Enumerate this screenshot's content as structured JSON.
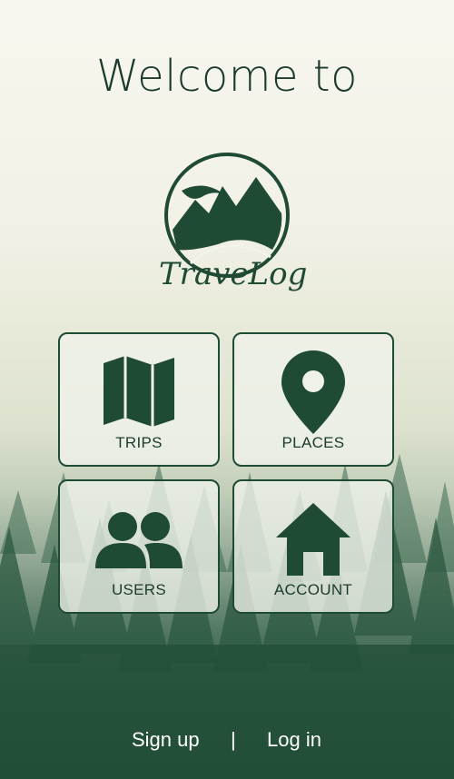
{
  "header": {
    "title": "Welcome to"
  },
  "brand": {
    "name": "TraveLog",
    "logo_icon": "mountain-logo-icon"
  },
  "tiles": [
    {
      "label": "TRIPS",
      "icon": "map-icon"
    },
    {
      "label": "PLACES",
      "icon": "location-pin-icon"
    },
    {
      "label": "USERS",
      "icon": "users-icon"
    },
    {
      "label": "ACCOUNT",
      "icon": "home-icon"
    }
  ],
  "footer": {
    "signup": "Sign up",
    "separator": "|",
    "login": "Log in"
  },
  "colors": {
    "primary": "#1f4a33",
    "tile_bg": "#f0f2ea",
    "footer_text": "#ffffff"
  }
}
